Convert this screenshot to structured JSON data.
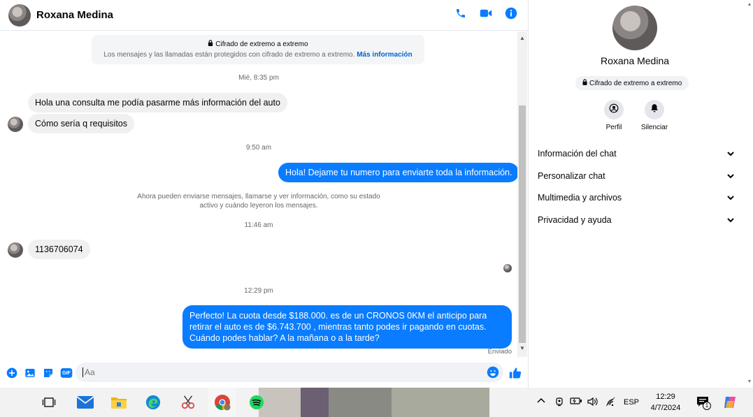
{
  "header": {
    "contact_name": "Roxana Medina"
  },
  "encryption": {
    "title": "Cifrado de extremo a extremo",
    "subtitle": "Los mensajes y las llamadas están protegidos con cifrado de extremo a extremo.",
    "link": "Más información"
  },
  "timestamps": {
    "t1": "Mié, 8:35 pm",
    "t2": "9:50 am",
    "t3": "11:46 am",
    "t4": "12:29 pm"
  },
  "messages": {
    "m1": "Hola una consulta me podía pasarme más información  del auto",
    "m2": "Cómo sería q requisitos",
    "m3": "Hola! Dejame tu numero  para enviarte toda la información.",
    "m4": "1136706074",
    "m5": "Perfecto! La cuota desde $188.000. es de un CRONOS 0KM el anticipo para retirar el auto es de $6.743.700 , mientras tanto podes ir pagando en cuotas. Cuándo podes hablar? A la mañana o a la tarde?"
  },
  "notice": "Ahora pueden enviarse mensajes, llamarse y ver información, como su estado activo y cuándo leyeron los mensajes.",
  "sent_label": "Enviado",
  "composer": {
    "placeholder": "Aa",
    "gif_label": "GIF"
  },
  "panel": {
    "name": "Roxana Medina",
    "badge": "Cifrado de extremo a extremo",
    "actions": [
      "Perfil",
      "Silenciar"
    ],
    "sections": [
      "Información del chat",
      "Personalizar chat",
      "Multimedia y archivos",
      "Privacidad y ayuda"
    ]
  },
  "taskbar": {
    "language": "ESP",
    "time": "12:29",
    "date": "4/7/2024",
    "notification_count": "1"
  },
  "colors": {
    "accent": "#0a7cff",
    "link": "#0064d1"
  }
}
